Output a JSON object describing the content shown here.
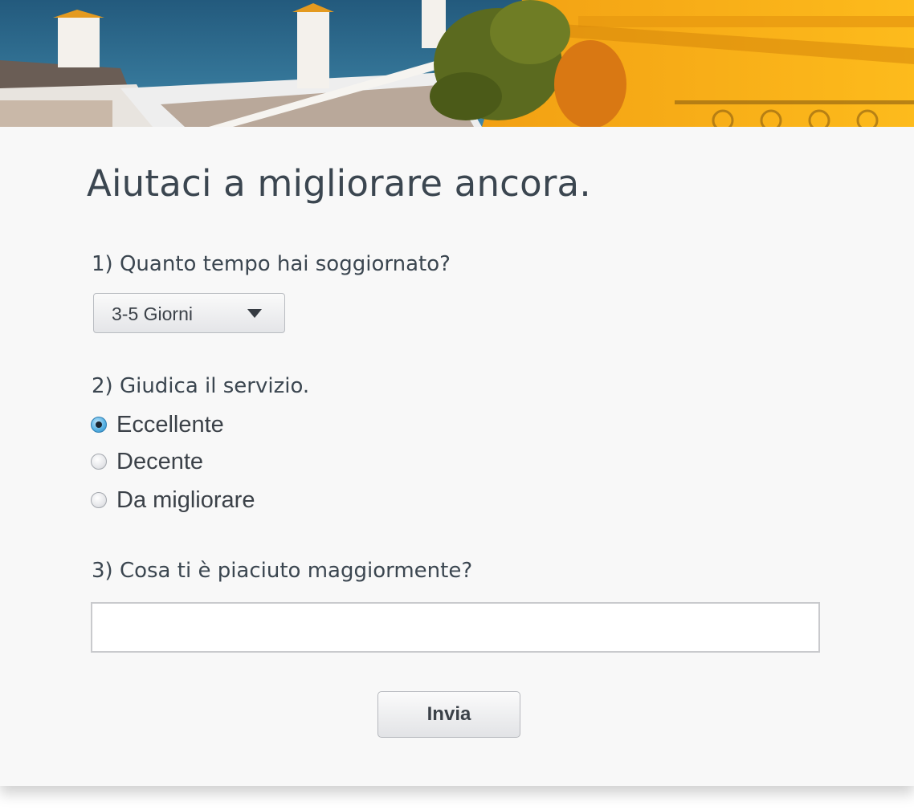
{
  "survey": {
    "title": "Aiutaci a migliorare ancora.",
    "questions": [
      {
        "label": "1) Quanto tempo hai soggiornato?",
        "type": "select",
        "selected": "3-5 Giorni"
      },
      {
        "label": "2) Giudica il servizio.",
        "type": "radio",
        "options": [
          {
            "label": "Eccellente",
            "checked": true
          },
          {
            "label": "Decente",
            "checked": false
          },
          {
            "label": "Da migliorare",
            "checked": false
          }
        ]
      },
      {
        "label": "3) Cosa ti è piaciuto maggiormente?",
        "type": "text",
        "value": ""
      }
    ],
    "submit_label": "Invia"
  },
  "icons": {
    "dropdown": "caret-down-icon",
    "radio_checked": "radio-checked-icon",
    "radio_unchecked": "radio-unchecked-icon"
  },
  "colors": {
    "text": "#3b4650",
    "background": "#f8f8f8",
    "radio_accent": "#5cb4e4",
    "banner_yellow": "#f6b21a",
    "sea_blue": "#2f6f93"
  }
}
